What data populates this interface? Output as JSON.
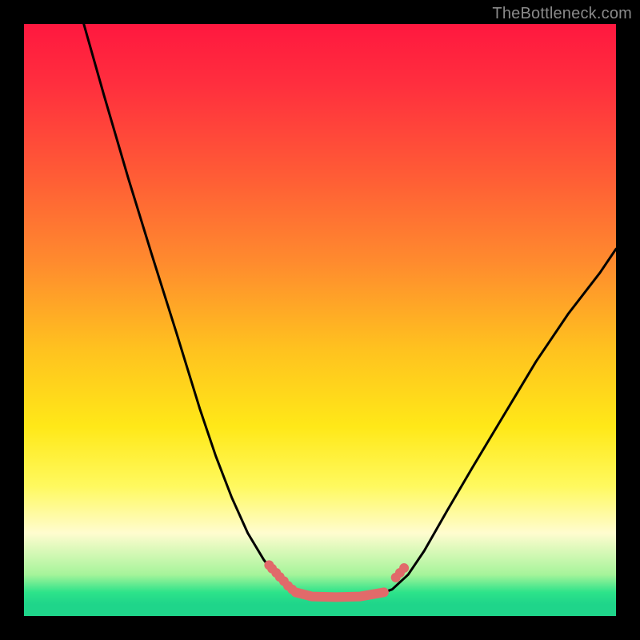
{
  "watermark": {
    "text": "TheBottleneck.com"
  },
  "chart_data": {
    "type": "line",
    "title": "",
    "xlabel": "",
    "ylabel": "",
    "xlim": [
      0,
      100
    ],
    "ylim": [
      0,
      100
    ],
    "grid": false,
    "legend": false,
    "background": "rainbow-vertical-gradient",
    "series": [
      {
        "name": "left-arm",
        "stroke": "#000000",
        "x": [
          10.1,
          13.5,
          17.6,
          21.6,
          25.7,
          29.7,
          32.4,
          35.1,
          37.8,
          40.5,
          43.2,
          44.6,
          45.3,
          45.9
        ],
        "y": [
          100.0,
          88.0,
          74.0,
          61.0,
          48.0,
          35.0,
          27.0,
          20.0,
          14.0,
          9.5,
          6.0,
          4.5,
          4.0,
          4.0
        ]
      },
      {
        "name": "right-arm",
        "stroke": "#000000",
        "x": [
          60.8,
          62.2,
          64.9,
          67.6,
          71.6,
          75.7,
          81.1,
          86.5,
          91.9,
          97.3,
          100.0
        ],
        "y": [
          4.0,
          4.5,
          7.0,
          11.0,
          18.0,
          25.0,
          34.0,
          43.0,
          51.0,
          58.0,
          62.0
        ]
      },
      {
        "name": "valley-floor",
        "stroke": "#e16a6a",
        "thick": true,
        "x": [
          45.9,
          48.6,
          52.7,
          56.8,
          60.8
        ],
        "y": [
          4.0,
          3.3,
          3.2,
          3.3,
          4.0
        ]
      },
      {
        "name": "left-bead-cluster",
        "stroke": "#e16a6a",
        "dots": true,
        "x": [
          41.4,
          41.9,
          42.6,
          43.2,
          43.9,
          44.6,
          45.3
        ],
        "y": [
          8.6,
          8.0,
          7.3,
          6.6,
          5.9,
          5.1,
          4.5
        ]
      },
      {
        "name": "right-bead-cluster",
        "stroke": "#e16a6a",
        "dots": true,
        "x": [
          62.8,
          63.5,
          64.2
        ],
        "y": [
          6.5,
          7.3,
          8.1
        ]
      }
    ]
  }
}
